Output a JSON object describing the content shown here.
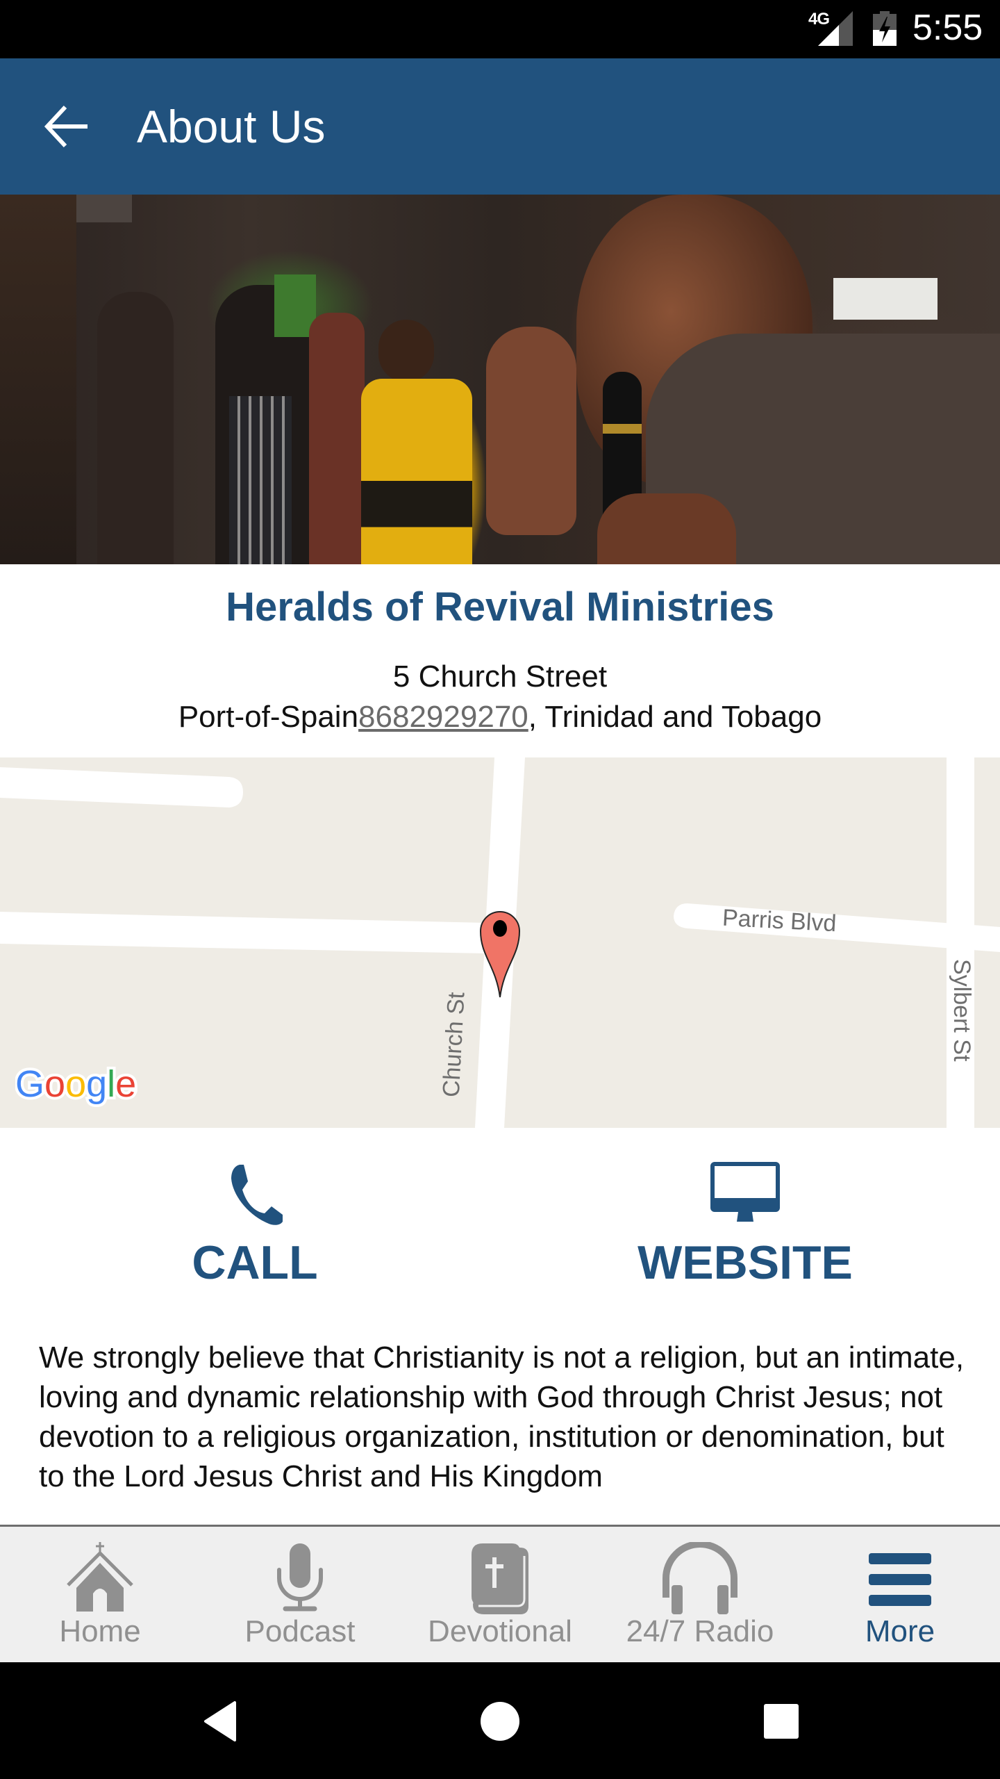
{
  "status_bar": {
    "network": "4G",
    "time": "5:55"
  },
  "app_bar": {
    "back_icon": "arrow-left-icon",
    "title": "About Us"
  },
  "hero": {
    "description": "Preacher speaking into a microphone in front of a congregation"
  },
  "organization": {
    "name": "Heralds of Revival Ministries",
    "address_line1": "5 Church Street",
    "city": "Port-of-Spain",
    "phone": "8682929270",
    "country_suffix": ", Trinidad and Tobago"
  },
  "map": {
    "streets": [
      "Church St",
      "Parris Blvd",
      "Sylbert St"
    ],
    "marker_icon": "map-pin-icon",
    "attribution": "Google"
  },
  "actions": [
    {
      "label": "CALL",
      "icon": "phone-icon"
    },
    {
      "label": "WEBSITE",
      "icon": "monitor-icon"
    }
  ],
  "about_text": "We strongly believe that Christianity is not a religion, but an intimate, loving and dynamic relationship with God through Christ Jesus; not devotion to a religious organization, institution or denomination, but to the Lord Jesus Christ and His Kingdom",
  "tab_bar": {
    "items": [
      {
        "label": "Home",
        "icon": "church-icon",
        "active": false
      },
      {
        "label": "Podcast",
        "icon": "microphone-icon",
        "active": false
      },
      {
        "label": "Devotional",
        "icon": "bible-icon",
        "active": false
      },
      {
        "label": "24/7 Radio",
        "icon": "headphones-icon",
        "active": false
      },
      {
        "label": "More",
        "icon": "menu-icon",
        "active": true
      }
    ]
  },
  "colors": {
    "brand": "#21527e",
    "tab_inactive": "#909090",
    "map_land": "#efece5",
    "marker": "#f07466"
  }
}
